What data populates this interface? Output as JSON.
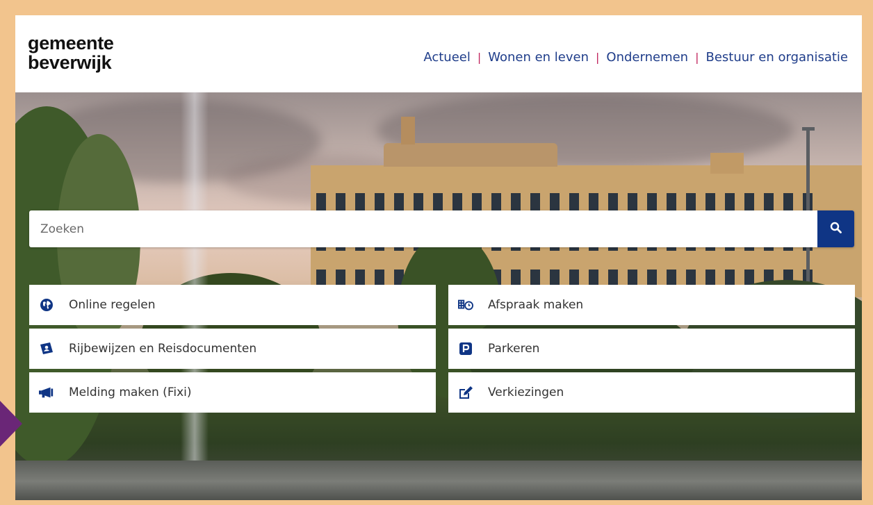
{
  "logo": {
    "line1": "gemeente",
    "line2": "beverwijk"
  },
  "nav": {
    "items": [
      {
        "label": "Actueel"
      },
      {
        "label": "Wonen en leven"
      },
      {
        "label": "Ondernemen"
      },
      {
        "label": "Bestuur en organisatie"
      }
    ],
    "separator": "|"
  },
  "search": {
    "placeholder": "Zoeken",
    "button_icon": "search-icon"
  },
  "tiles": [
    {
      "label": "Online regelen",
      "icon": "globe-icon"
    },
    {
      "label": "Afspraak maken",
      "icon": "calendar-clock-icon"
    },
    {
      "label": "Rijbewijzen en Reisdocumenten",
      "icon": "id-card-icon"
    },
    {
      "label": "Parkeren",
      "icon": "parking-icon"
    },
    {
      "label": "Melding maken (Fixi)",
      "icon": "megaphone-icon"
    },
    {
      "label": "Verkiezingen",
      "icon": "pencil-edit-icon"
    }
  ],
  "colors": {
    "frame": "#f2c48d",
    "nav_text": "#1f3d8a",
    "nav_separator": "#c0235c",
    "search_button": "#0f3585",
    "icon": "#0f3585",
    "pointer": "#6a2677"
  }
}
